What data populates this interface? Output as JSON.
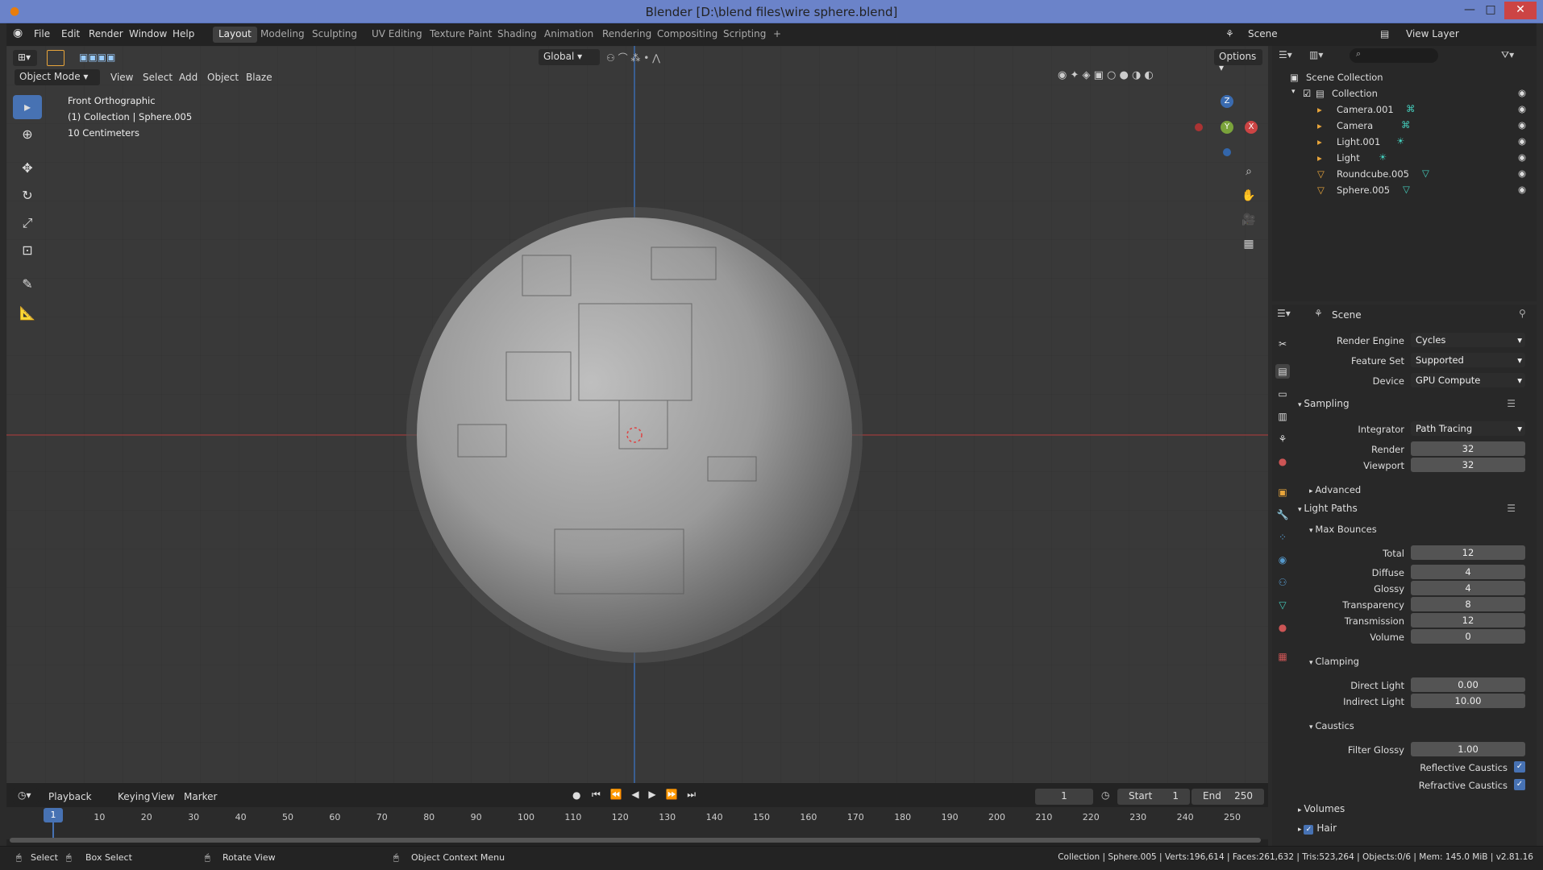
{
  "window": {
    "title": "Blender [D:\\blend files\\wire sphere.blend]"
  },
  "menu": {
    "file": "File",
    "edit": "Edit",
    "render": "Render",
    "window": "Window",
    "help": "Help"
  },
  "workspaces": [
    "Layout",
    "Modeling",
    "Sculpting",
    "UV Editing",
    "Texture Paint",
    "Shading",
    "Animation",
    "Rendering",
    "Compositing",
    "Scripting",
    "+"
  ],
  "top_right": {
    "scene": "Scene",
    "view_layer": "View Layer"
  },
  "viewport": {
    "mode": "Object Mode",
    "menu": [
      "View",
      "Select",
      "Add",
      "Object",
      "Blaze"
    ],
    "transform": "Global",
    "options": "Options",
    "overlay": {
      "view": "Front Orthographic",
      "collection": "(1) Collection | Sphere.005",
      "scale": "10 Centimeters"
    }
  },
  "outliner": {
    "root": "Scene Collection",
    "collection": "Collection",
    "items": [
      "Camera.001",
      "Camera",
      "Light.001",
      "Light",
      "Roundcube.005",
      "Sphere.005"
    ]
  },
  "properties": {
    "header": "Scene",
    "render_engine_label": "Render Engine",
    "render_engine": "Cycles",
    "feature_set_label": "Feature Set",
    "feature_set": "Supported",
    "device_label": "Device",
    "device": "GPU Compute",
    "sampling": "Sampling",
    "integrator_label": "Integrator",
    "integrator": "Path Tracing",
    "render_label": "Render",
    "render": "32",
    "viewport_label": "Viewport",
    "viewport": "32",
    "advanced": "Advanced",
    "light_paths": "Light Paths",
    "max_bounces": "Max Bounces",
    "total_label": "Total",
    "total": "12",
    "diffuse_label": "Diffuse",
    "diffuse": "4",
    "glossy_label": "Glossy",
    "glossy": "4",
    "transparency_label": "Transparency",
    "transparency": "8",
    "transmission_label": "Transmission",
    "transmission": "12",
    "volume_label": "Volume",
    "volume": "0",
    "clamping": "Clamping",
    "direct_label": "Direct Light",
    "direct": "0.00",
    "indirect_label": "Indirect Light",
    "indirect": "10.00",
    "caustics": "Caustics",
    "filter_glossy_label": "Filter Glossy",
    "filter_glossy": "1.00",
    "reflective_label": "Reflective Caustics",
    "refractive_label": "Refractive Caustics",
    "volumes": "Volumes",
    "hair": "Hair"
  },
  "timeline": {
    "playback": "Playback",
    "keying": "Keying",
    "view": "View",
    "marker": "Marker",
    "frame": "1",
    "start_label": "Start",
    "start": "1",
    "end_label": "End",
    "end": "250",
    "ticks": [
      "1",
      "10",
      "20",
      "30",
      "40",
      "50",
      "60",
      "70",
      "80",
      "90",
      "100",
      "110",
      "120",
      "130",
      "140",
      "150",
      "160",
      "170",
      "180",
      "190",
      "200",
      "210",
      "220",
      "230",
      "240",
      "250"
    ]
  },
  "statusbar": {
    "select": "Select",
    "box_select": "Box Select",
    "rotate": "Rotate View",
    "context": "Object Context Menu",
    "stats": "Collection | Sphere.005 | Verts:196,614 | Faces:261,632 | Tris:523,264 | Objects:0/6 | Mem: 145.0 MiB | v2.81.16"
  },
  "colors": {
    "accent": "#4772b3",
    "x_axis": "#a33a3a",
    "z_axis": "#3a6bb0",
    "title_bar": "#6b83c9"
  }
}
